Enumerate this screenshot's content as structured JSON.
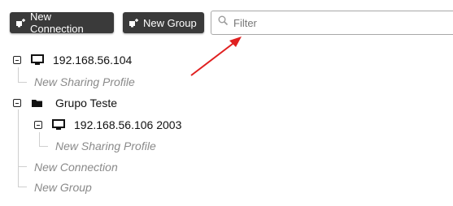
{
  "toolbar": {
    "new_connection": "New Connection",
    "new_group": "New Group"
  },
  "filter": {
    "placeholder": "Filter"
  },
  "tree": {
    "conn1": {
      "label": "192.168.56.104",
      "sharing": "New Sharing Profile"
    },
    "group1": {
      "label": "Grupo Teste",
      "conn": {
        "label": "192.168.56.106 2003",
        "sharing": "New Sharing Profile"
      },
      "new_connection": "New Connection",
      "new_group": "New Group"
    }
  },
  "annotation": {
    "arrow_color": "#e02020"
  }
}
